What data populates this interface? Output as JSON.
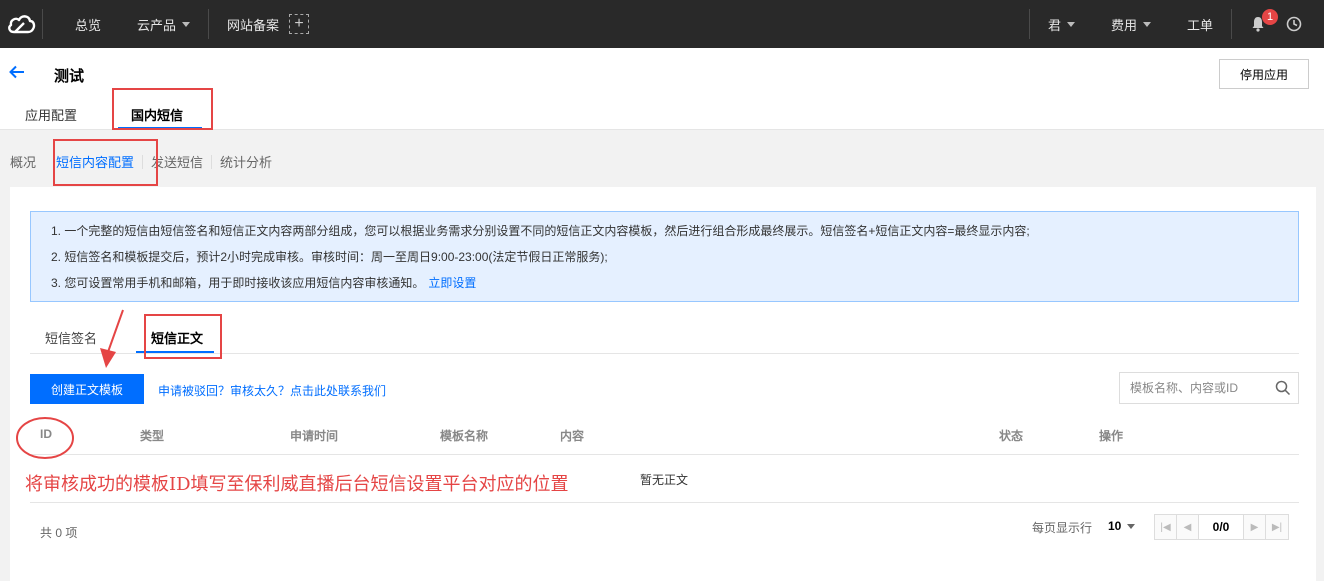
{
  "topbar": {
    "nav": [
      "总览",
      "云产品",
      "网站备案"
    ],
    "plus_icon": "plus-icon",
    "right": [
      "君",
      "费用",
      "工单"
    ],
    "badge_count": "1"
  },
  "header": {
    "title": "测试",
    "stop_button": "停用应用",
    "tabs": [
      "应用配置",
      "国内短信"
    ]
  },
  "subnav": {
    "items": [
      "概况",
      "短信内容配置",
      "发送短信",
      "统计分析"
    ]
  },
  "notice": {
    "lines": [
      "1. 一个完整的短信由短信签名和短信正文内容两部分组成，您可以根据业务需求分别设置不同的短信正文内容模板，然后进行组合形成最终展示。短信签名+短信正文内容=最终显示内容;",
      "2. 短信签名和模板提交后，预计2小时完成审核。审核时间：周一至周日9:00-23:00(法定节假日正常服务);",
      "3. 您可设置常用手机和邮箱，用于即时接收该应用短信内容审核通知。"
    ],
    "link": "立即设置"
  },
  "inner_tabs": [
    "短信签名",
    "短信正文"
  ],
  "toolbar": {
    "create_button": "创建正文模板",
    "help_link": "申请被驳回？审核太久？点击此处联系我们",
    "search_placeholder": "模板名称、内容或ID"
  },
  "table": {
    "columns": [
      "ID",
      "类型",
      "申请时间",
      "模板名称",
      "内容",
      "状态",
      "操作"
    ],
    "empty_text": "暂无正文"
  },
  "annotation": "将审核成功的模板ID填写至保利威直播后台短信设置平台对应的位置",
  "footer": {
    "total": "共 0 项",
    "per_page_label": "每页显示行",
    "per_page_value": "10",
    "page": "0/0"
  },
  "colors": {
    "topbar": "#292929",
    "accent": "#006eff",
    "annotation_red": "#e54545",
    "notice_bg": "#e5f0ff"
  }
}
